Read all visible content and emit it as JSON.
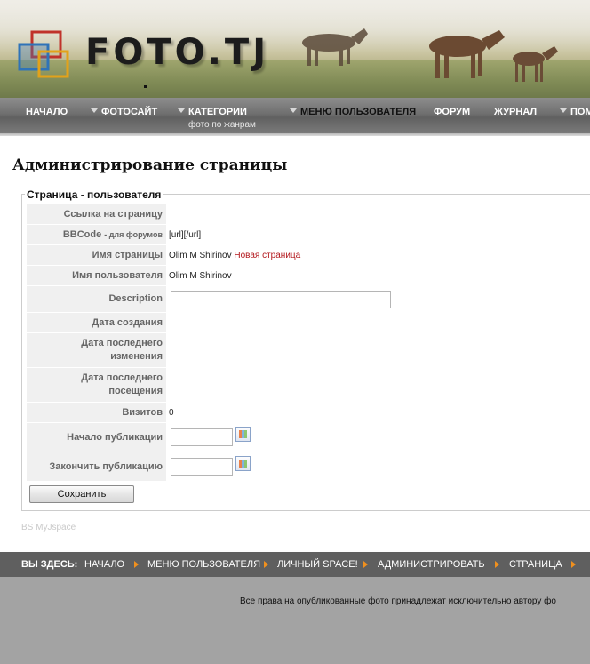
{
  "header": {
    "logo_text": "FOTO.TJ"
  },
  "nav": {
    "items": [
      {
        "label": "НАЧАЛО"
      },
      {
        "label": "ФОТОСАЙТ"
      },
      {
        "label": "КАТЕГОРИИ",
        "sub": "фото по жанрам"
      },
      {
        "label": "МЕНЮ ПОЛЬЗОВАТЕЛЯ"
      },
      {
        "label": "ФОРУМ"
      },
      {
        "label": "ЖУРНАЛ"
      },
      {
        "label": "ПОМ"
      }
    ]
  },
  "page": {
    "title": "Администрирование страницы",
    "legend": "Страница - пользователя"
  },
  "form": {
    "link_label": "Ссылка на страницу",
    "bbcode_label": "BBCode",
    "bbcode_note": "- для форумов",
    "bbcode_value": "[url][/url]",
    "page_name_label": "Имя страницы",
    "page_name_user": "Olim M Shirinov",
    "page_name_title": "Новая страница",
    "username_label": "Имя пользователя",
    "username_value": "Olim M Shirinov",
    "description_label": "Description",
    "description_value": "",
    "created_label": "Дата создания",
    "modified_label": "Дата последнего изменения",
    "visited_label": "Дата последнего посещения",
    "visits_label": "Визитов",
    "visits_value": "0",
    "publish_start_label": "Начало публикации",
    "publish_start_value": "",
    "publish_end_label": "Закончить публикацию",
    "publish_end_value": "",
    "save_label": "Сохранить"
  },
  "credit": "BS MyJspace",
  "breadcrumb": {
    "lead": "ВЫ ЗДЕСЬ:",
    "items": [
      "НАЧАЛО",
      "МЕНЮ ПОЛЬЗОВАТЕЛЯ",
      "ЛИЧНЫЙ SPACE!",
      "АДМИНИСТРИРОВАТЬ",
      "СТРАНИЦА"
    ]
  },
  "footer": {
    "text": "Все права на опубликованные фото принадлежат исключительно автору фо"
  },
  "colors": {
    "nav_bg": "#6f6f6f",
    "crumb_bg": "#5f5f5f",
    "footer_bg": "#a3a3a3",
    "accent_red": "#b3171c",
    "crumb_arrow": "#f0901e"
  }
}
